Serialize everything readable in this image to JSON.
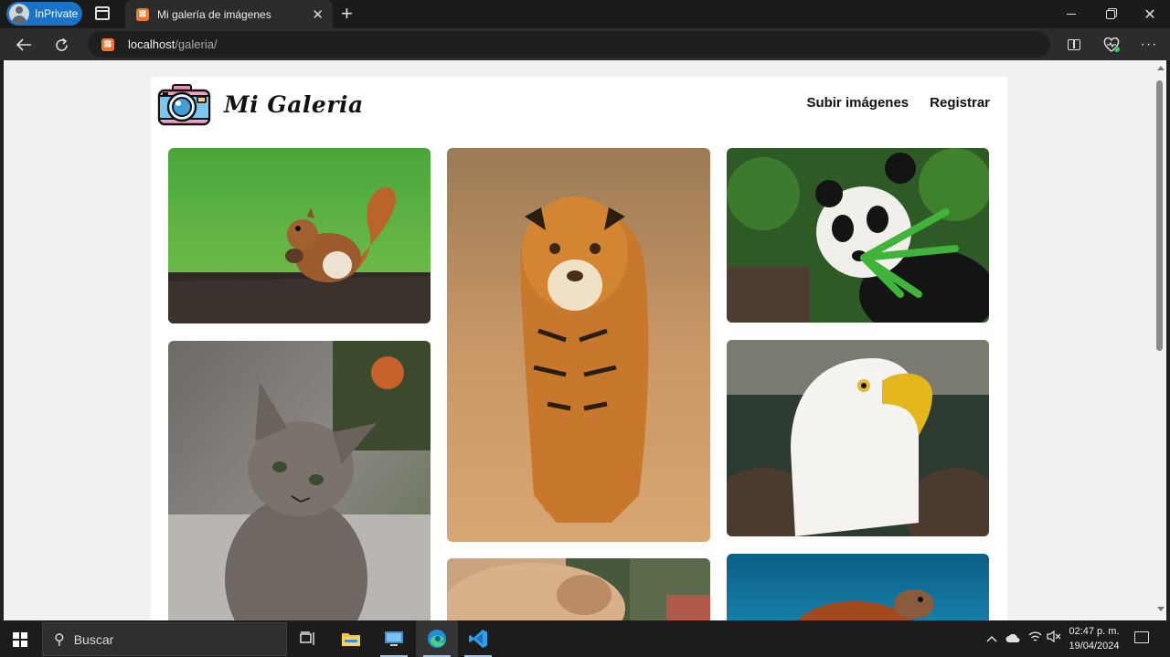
{
  "browser": {
    "profile_label": "InPrivate",
    "tab_title": "Mi galería de imágenes",
    "tab_close_glyph": "✕",
    "new_tab_glyph": "+",
    "url_host": "localhost",
    "url_path": "/galeria/",
    "favicon_glyph": "⊠"
  },
  "site": {
    "logo_text": "Mi Galeria",
    "nav": [
      "Subir imágenes",
      "Registrar"
    ]
  },
  "gallery": [
    {
      "animal": "squirrel"
    },
    {
      "animal": "tiger"
    },
    {
      "animal": "panda"
    },
    {
      "animal": "kitten"
    },
    {
      "animal": "bald-eagle"
    },
    {
      "animal": "lion-cub"
    },
    {
      "animal": "sea-turtle"
    }
  ],
  "taskbar": {
    "search_placeholder": "Buscar",
    "time": "02:47 p. m.",
    "date": "19/04/2024",
    "accent_color": "#9cc8f0"
  },
  "colors": {
    "inprivate_badge": "#1a73c9",
    "favicon": "#f0772a",
    "page_background": "#f1f1f1",
    "content_background": "#ffffff"
  }
}
